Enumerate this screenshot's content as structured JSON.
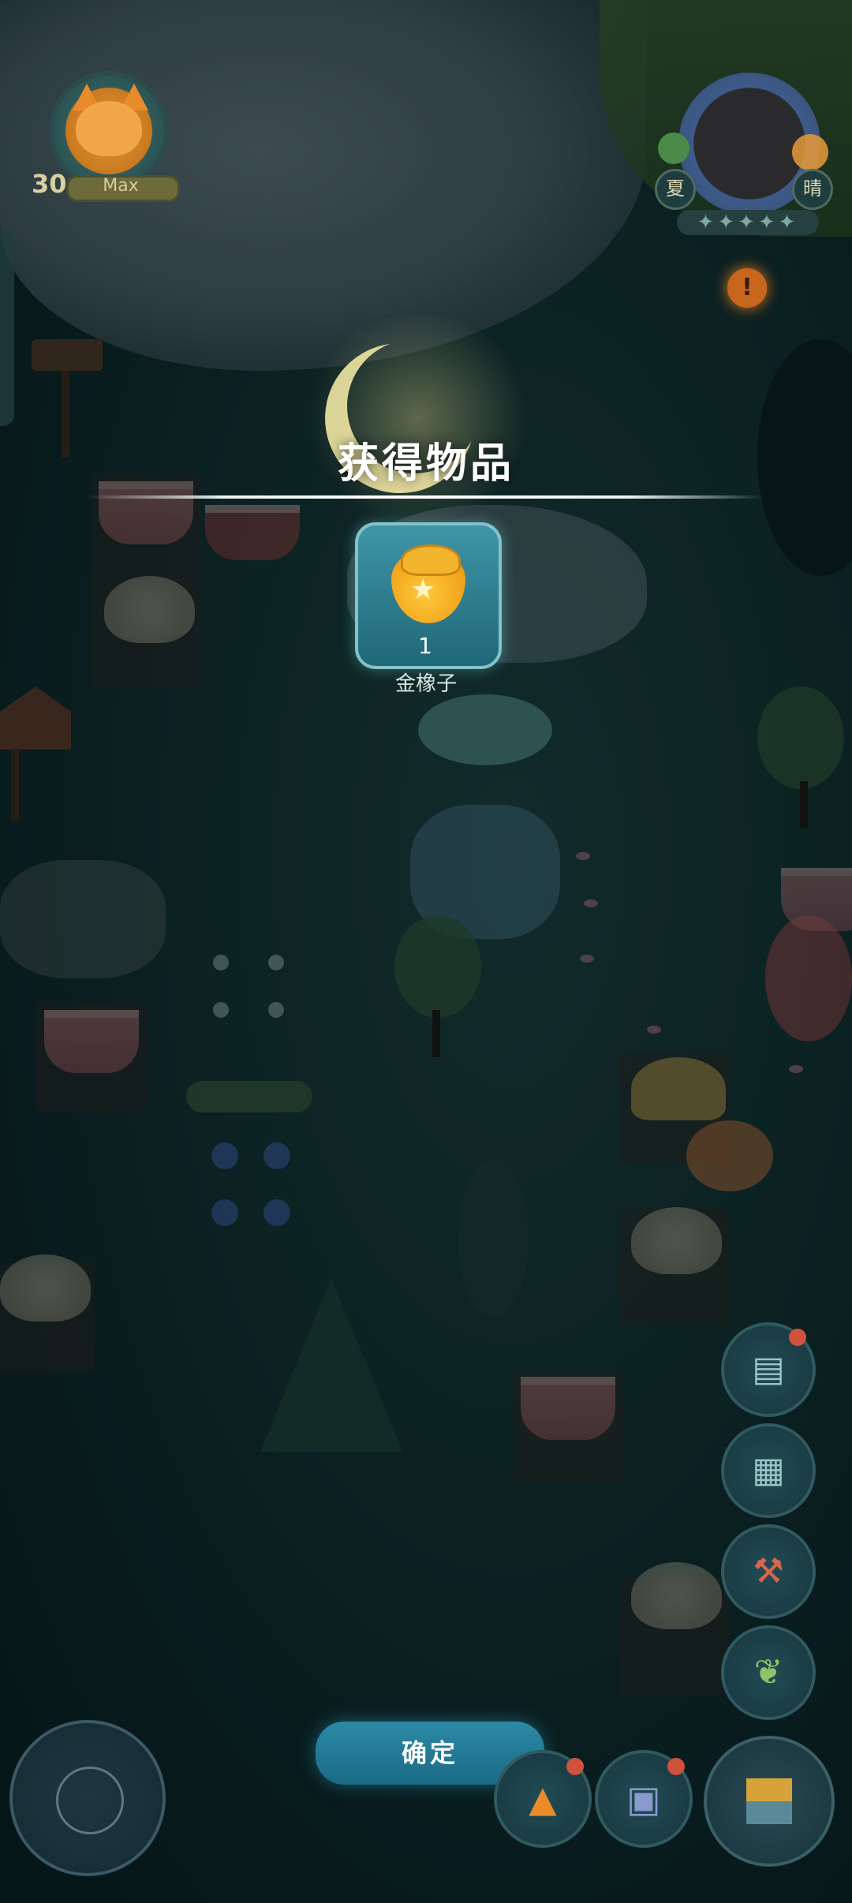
{
  "hud": {
    "player_level": "30",
    "level_status": "Max",
    "season": "夏",
    "weather": "晴",
    "star_rating": "✦✦✦✦✦",
    "alert_symbol": "!"
  },
  "popup": {
    "title": "获得物品",
    "item": {
      "name": "金橡子",
      "quantity": "1",
      "icon": "golden-acorn-icon"
    },
    "confirm_label": "确定"
  },
  "right_menu": [
    {
      "name": "journal-button",
      "icon": "book-icon",
      "has_badge": true
    },
    {
      "name": "collection-button",
      "icon": "grid-c-icon",
      "has_badge": false
    },
    {
      "name": "hammer-button",
      "icon": "hammer-icon",
      "has_badge": false
    },
    {
      "name": "sprout-button",
      "icon": "sprout-icon",
      "has_badge": false
    }
  ],
  "bottom_bar": [
    {
      "name": "moon-compass-button",
      "icon": "moon-dial-icon"
    },
    {
      "name": "pet-button",
      "icon": "fox-icon",
      "has_badge": true
    },
    {
      "name": "backpack-button",
      "icon": "backpack-icon",
      "has_badge": true
    },
    {
      "name": "compass-button",
      "icon": "compass-icon"
    }
  ],
  "colors": {
    "accent_teal": "#2c8aa6",
    "card_border": "#83c3c8",
    "badge_red": "#d0523e",
    "alert_orange": "#c9661e"
  }
}
